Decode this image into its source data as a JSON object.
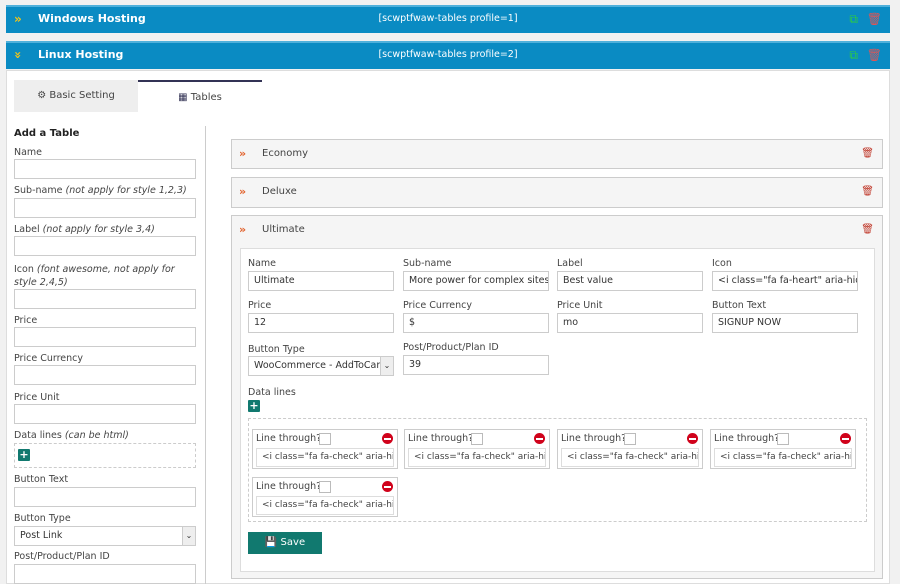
{
  "profiles": [
    {
      "title": "Windows Hosting",
      "shortcode": "[scwptfwaw-tables profile=1]"
    },
    {
      "title": "Linux Hosting",
      "shortcode": "[scwptfwaw-tables profile=2]"
    }
  ],
  "tabs": [
    {
      "label": "Basic Setting",
      "icon": "gear-icon"
    },
    {
      "label": "Tables",
      "icon": "grid-icon"
    }
  ],
  "add_table": {
    "heading": "Add a Table",
    "name_label": "Name",
    "subname_label": "Sub-name",
    "subname_note": "(not apply for style 1,2,3)",
    "label_label": "Label",
    "label_note": "(not apply for style 3,4)",
    "icon_label": "Icon",
    "icon_note": "(font awesome, not apply for style 2,4,5)",
    "price_label": "Price",
    "currency_label": "Price Currency",
    "unit_label": "Price Unit",
    "datalines_label": "Data lines",
    "datalines_note": "(can be html)",
    "button_text_label": "Button Text",
    "button_type_label": "Button Type",
    "button_type_value": "Post Link",
    "post_id_label": "Post/Product/Plan ID"
  },
  "tables": [
    {
      "name": "Economy"
    },
    {
      "name": "Deluxe"
    },
    {
      "name": "Ultimate"
    }
  ],
  "ultimate": {
    "name_label": "Name",
    "name": "Ultimate",
    "subname_label": "Sub-name",
    "subname": "More power for complex sites",
    "label_label": "Label",
    "label": "Best value",
    "icon_label": "Icon",
    "icon": "<i class=\"fa fa-heart\" aria-hidden=\"true\"></i>",
    "price_label": "Price",
    "price": "12",
    "currency_label": "Price Currency",
    "currency": "$",
    "unit_label": "Price Unit",
    "unit": "mo",
    "button_text_label": "Button Text",
    "button_text": "SIGNUP NOW",
    "button_type_label": "Button Type",
    "button_type": "WooCommerce - AddToCart",
    "post_id_label": "Post/Product/Plan ID",
    "post_id": "39",
    "datalines_label": "Data lines",
    "line_through_label": "Line through?",
    "data_lines": [
      "<i class=\"fa fa-check\" aria-hidden=\"true\"></i>",
      "<i class=\"fa fa-check\" aria-hidden=\"true\"></i>",
      "<i class=\"fa fa-check\" aria-hidden=\"true\"></i>",
      "<i class=\"fa fa-check\" aria-hidden=\"true\"></i>",
      "<i class=\"fa fa-check\" aria-hidden=\"true\"></i>"
    ],
    "save_label": "Save"
  },
  "colors": {
    "header": "#0a8bc3",
    "save": "#11796f",
    "delete": "#d0021b"
  }
}
